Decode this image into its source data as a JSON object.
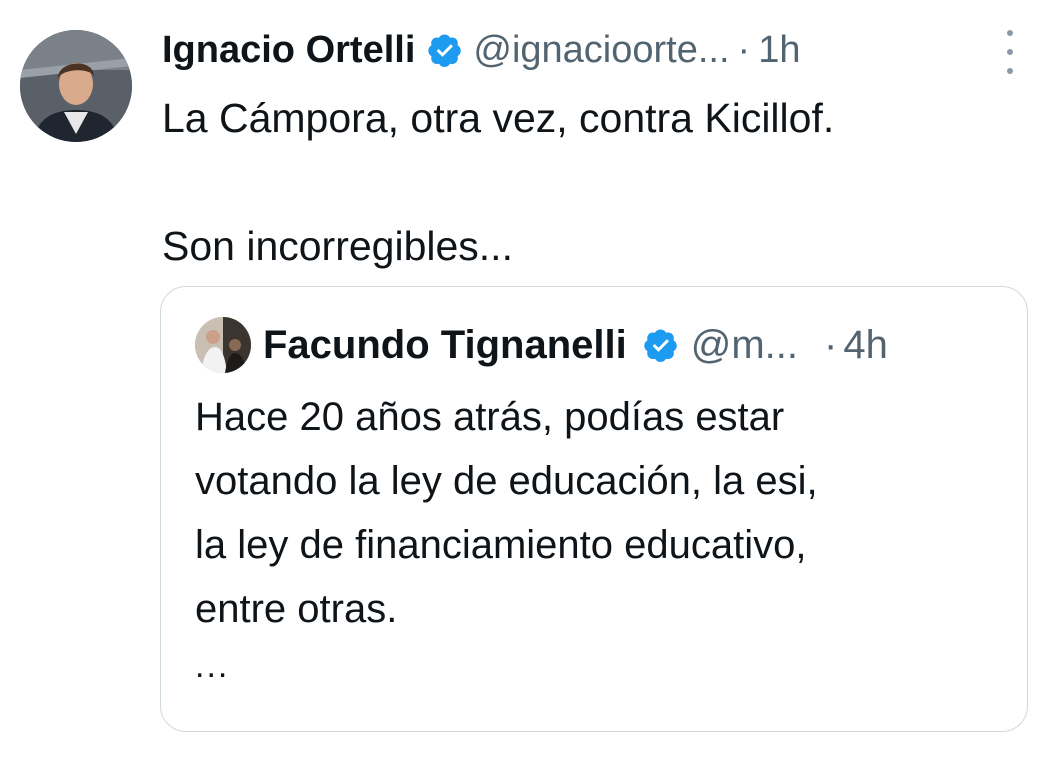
{
  "tweet": {
    "author_name": "Ignacio Ortelli",
    "handle": "@ignacioorte...",
    "separator": "·",
    "time": "1h",
    "text_line1": "La Cámpora, otra vez, contra Kicillof.",
    "text_line2": "Son incorregibles..."
  },
  "quoted_tweet": {
    "author_name": "Facundo Tignanelli",
    "handle": "@m...",
    "separator": "·",
    "time": "4h",
    "lines": [
      "Hace 20 años atrás, podías estar",
      "votando la ley de educación, la esi,",
      "la ley de financiamiento educativo,",
      "entre otras."
    ],
    "truncation": "..."
  },
  "colors": {
    "verified": "#1d9bf0",
    "secondary_text": "#536471",
    "border": "#cfd9de"
  },
  "icons": {
    "verified": "verified-badge-icon",
    "more": "more-vertical-icon"
  }
}
